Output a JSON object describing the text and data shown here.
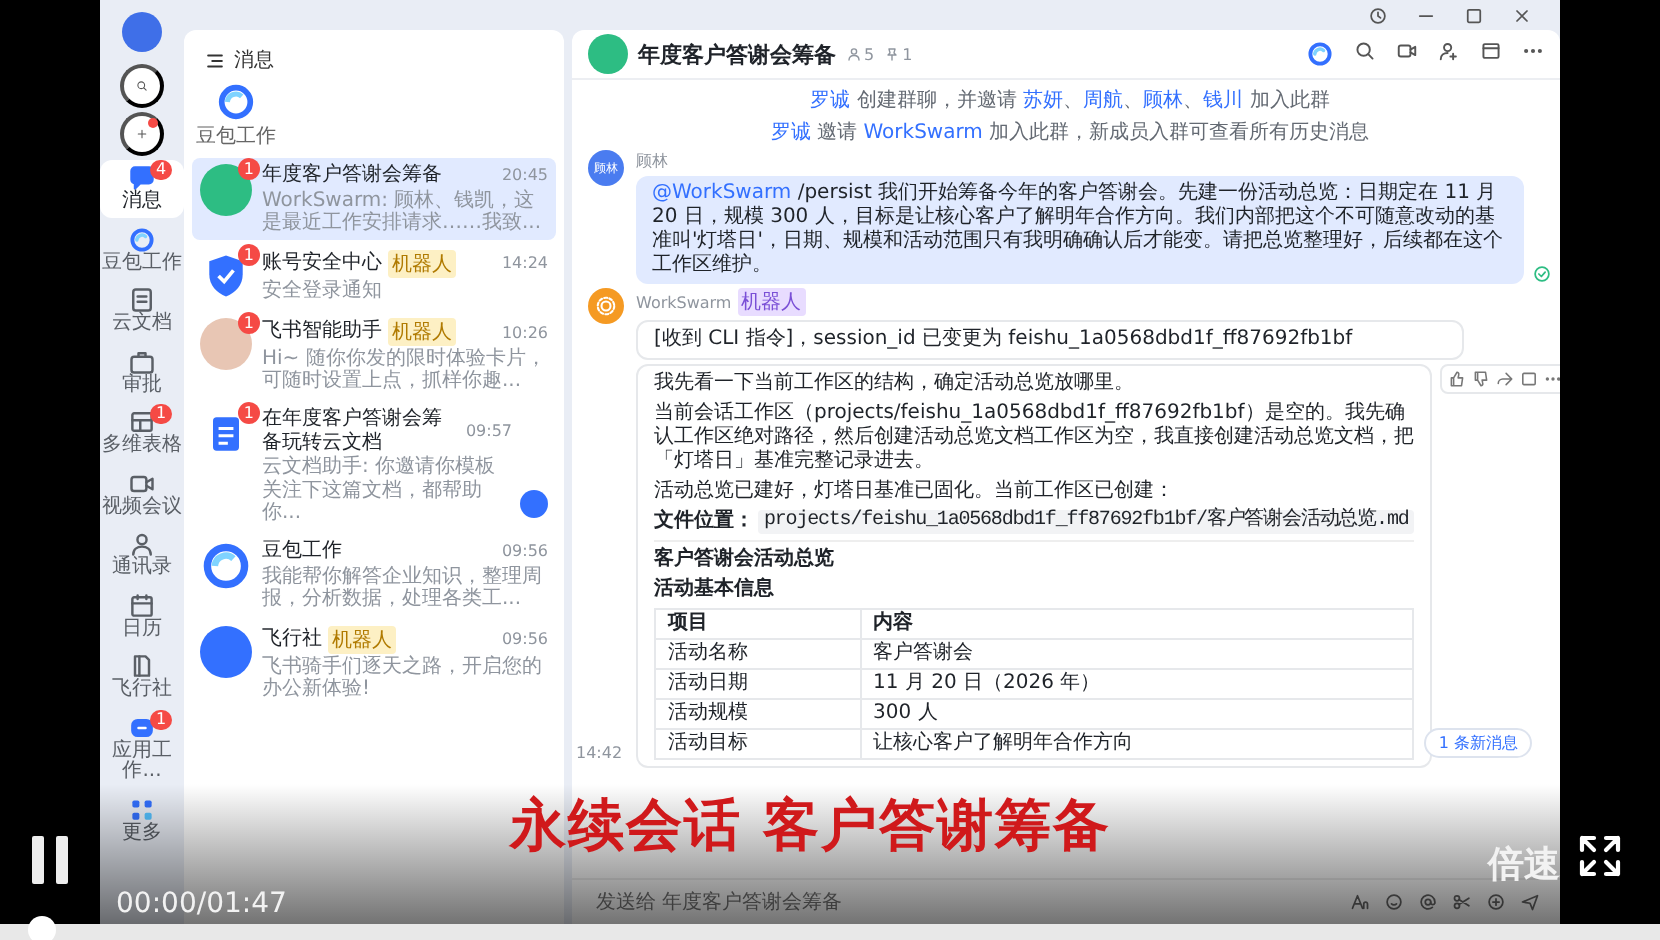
{
  "nav": {
    "items": [
      {
        "label": "消息",
        "badge": "4",
        "selected": true
      },
      {
        "label": "豆包工作",
        "selected": false
      },
      {
        "label": "云文档",
        "selected": false
      },
      {
        "label": "审批",
        "selected": false
      },
      {
        "label": "多维表格",
        "badge": "1",
        "selected": false
      },
      {
        "label": "视频会议",
        "selected": false
      },
      {
        "label": "通讯录",
        "selected": false
      },
      {
        "label": "日历",
        "selected": false
      },
      {
        "label": "飞行社",
        "selected": false
      },
      {
        "label": "应用工作...",
        "badge": "1",
        "selected": false
      },
      {
        "label": "更多",
        "selected": false
      }
    ]
  },
  "chat_list": {
    "title": "消息",
    "shortcut": "豆包工作",
    "items": [
      {
        "kind": "group",
        "name": "年度客户答谢会筹备",
        "time": "20:45",
        "preview": "WorkSwarm: 顾林、钱凯，这是最近工作安排请求……我致...",
        "badge": "1",
        "selected": true,
        "shortcut_icon": false
      },
      {
        "kind": "shield",
        "name": "账号安全中心",
        "tag": "机器人",
        "time": "14:24",
        "preview": "安全登录通知",
        "badge": "1",
        "selected": false,
        "shortcut_icon": false
      },
      {
        "kind": "person",
        "name": "飞书智能助手",
        "tag": "机器人",
        "time": "10:26",
        "preview": "Hi~ 随你你发的限时体验卡片，可随时设置上点，抓样你趣...",
        "badge": "1",
        "selected": false,
        "shortcut_icon": false
      },
      {
        "kind": "doc",
        "name": "在年度客户答谢会筹备玩转云文档",
        "time": "09:57",
        "preview": "云文档助手: 你邀请你模板关注下这篇文档，都帮助你...",
        "badge": "1",
        "selected": false,
        "shortcut_icon": true
      },
      {
        "kind": "swirl",
        "name": "豆包工作",
        "time": "09:56",
        "preview": "我能帮你解答企业知识，整理周报，分析数据，处理各类工...",
        "selected": false,
        "shortcut_icon": false
      },
      {
        "kind": "app",
        "name": "飞行社",
        "tag": "机器人",
        "time": "09:56",
        "preview": "飞书骑手们逐天之路，开启您的办公新体验!",
        "selected": false,
        "shortcut_icon": false
      }
    ]
  },
  "chat": {
    "title": "年度客户答谢会筹备",
    "member_count": "5",
    "pin_count": "1",
    "system_messages": [
      [
        {
          "text": "罗诚",
          "kind": "name"
        },
        {
          "text": " 创建群聊，并邀请 ",
          "kind": "plain"
        },
        {
          "text": "苏妍",
          "kind": "name"
        },
        {
          "text": "、",
          "kind": "plain"
        },
        {
          "text": "周航",
          "kind": "name"
        },
        {
          "text": "、",
          "kind": "plain"
        },
        {
          "text": "顾林",
          "kind": "name"
        },
        {
          "text": "、",
          "kind": "plain"
        },
        {
          "text": "钱川",
          "kind": "name"
        },
        {
          "text": " 加入此群",
          "kind": "plain"
        }
      ],
      [
        {
          "text": "罗诚",
          "kind": "name"
        },
        {
          "text": " 邀请 ",
          "kind": "plain"
        },
        {
          "text": "WorkSwarm",
          "kind": "name"
        },
        {
          "text": " 加入此群，新成员入群可查看所有历史消息",
          "kind": "plain"
        }
      ]
    ],
    "messages": [
      {
        "kind": "user",
        "sender": "顾林",
        "avatar_text": "顾林",
        "mention": "@WorkSwarm",
        "text": " /persist 我们开始筹备今年的客户答谢会。先建一份活动总览：日期定在 11 月 20 日，规模 300 人，目标是让核心客户了解明年合作方向。我们内部把这个不可随意改动的基准叫'灯塔日'，日期、规模和活动范围只有我明确确认后才能变。请把总览整理好，后续都在这个工作区维护。",
        "read": true
      },
      {
        "kind": "bot",
        "sender": "WorkSwarm",
        "tag": "机器人",
        "bubbles": [
          [
            {
              "kind": "paragraph",
              "text": "[收到 CLI 指令]，session_id 已变更为 feishu_1a0568dbd1f_ff87692fb1bf"
            }
          ],
          [
            {
              "kind": "paragraph",
              "text": "我先看一下当前工作区的结构，确定活动总览放哪里。"
            },
            {
              "kind": "paragraph",
              "text": "当前会话工作区（projects/feishu_1a0568dbd1f_ff87692fb1bf）是空的。我先确认工作区绝对路径，然后创建活动总览文档工作区为空，我直接创建活动总览文档，把「灯塔日」基准完整记录进去。"
            },
            {
              "kind": "paragraph",
              "text": "活动总览已建好，灯塔日基准已固化。当前工作区已创建："
            },
            {
              "kind": "file",
              "label": "文件位置：",
              "path": "projects/feishu_1a0568dbd1f_ff87692fb1bf/客户答谢会活动总览.md"
            },
            {
              "kind": "heading",
              "text": "客户答谢会活动总览"
            },
            {
              "kind": "subheading",
              "text": "活动基本信息"
            },
            {
              "kind": "table",
              "columns": [
                "项目",
                "内容"
              ],
              "rows": [
                [
                  "活动名称",
                  "客户答谢会"
                ],
                [
                  "活动日期",
                  "11 月 20 日（2026 年）"
                ],
                [
                  "活动规模",
                  "300 人"
                ],
                [
                  "活动目标",
                  "让核心客户了解明年合作方向"
                ]
              ]
            }
          ]
        ]
      }
    ],
    "time": "14:42",
    "new_messages": "1 条新消息",
    "input": {
      "placeholder": "发送给 年度客户答谢会筹备"
    }
  },
  "video": {
    "playing": true,
    "time": "00:00/01:47",
    "subtitle": "永续会话 客户答谢筹备",
    "speed": "倍速",
    "level": 0
  }
}
